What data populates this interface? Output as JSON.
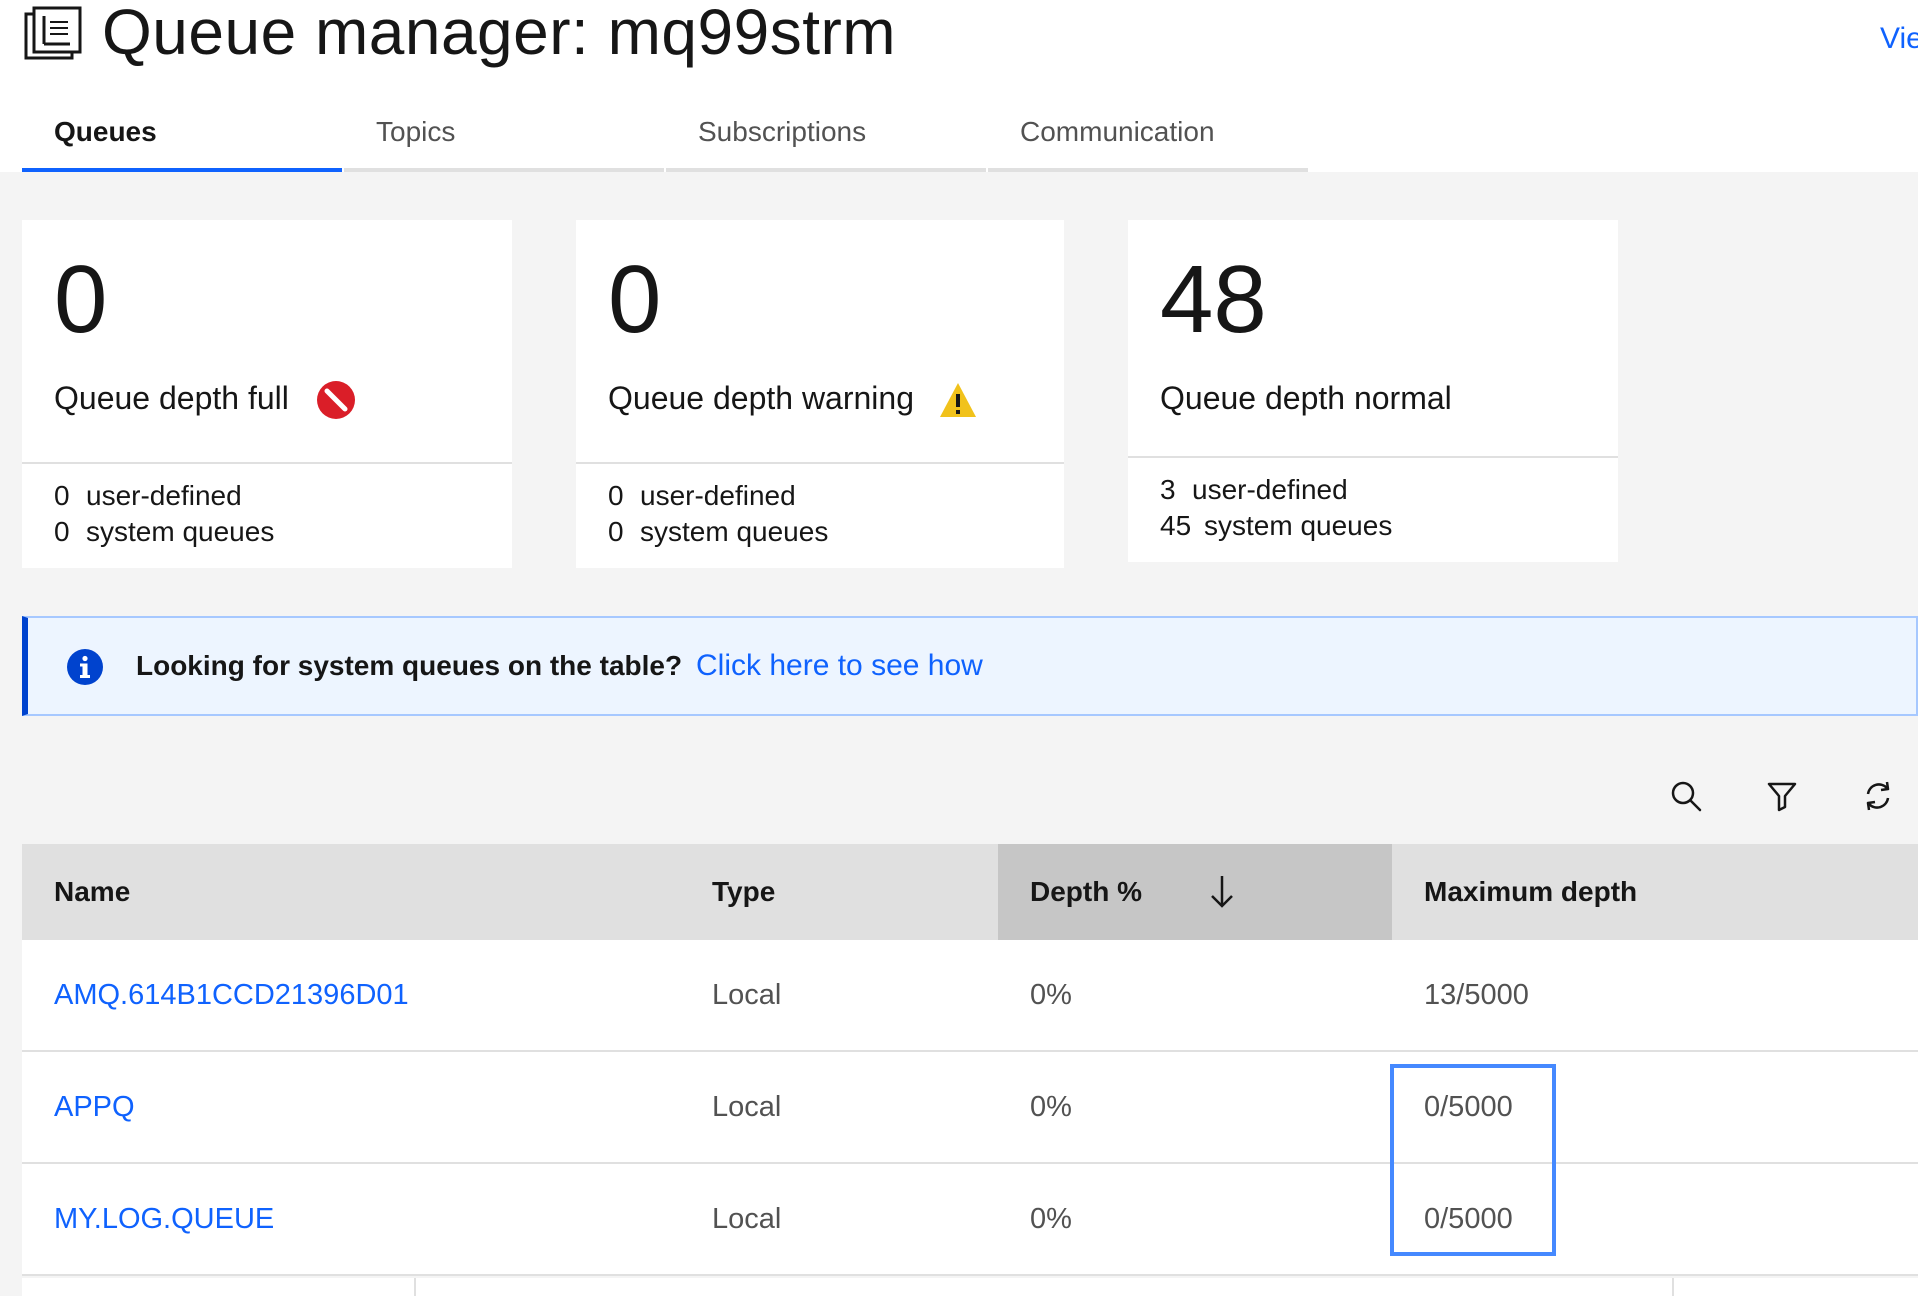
{
  "header": {
    "title": "Queue manager: mq99strm",
    "view_link": "Vie"
  },
  "tabs": [
    {
      "label": "Queues",
      "active": true
    },
    {
      "label": "Topics",
      "active": false
    },
    {
      "label": "Subscriptions",
      "active": false
    },
    {
      "label": "Communication",
      "active": false
    }
  ],
  "cards": [
    {
      "count": "0",
      "label": "Queue depth full",
      "status_icon": "blocked-icon",
      "user_defined_count": "0",
      "user_defined_label": "user-defined",
      "system_count": "0",
      "system_label": "system queues"
    },
    {
      "count": "0",
      "label": "Queue depth warning",
      "status_icon": "warning-icon",
      "user_defined_count": "0",
      "user_defined_label": "user-defined",
      "system_count": "0",
      "system_label": "system queues"
    },
    {
      "count": "48",
      "label": "Queue depth normal",
      "status_icon": "",
      "user_defined_count": "3",
      "user_defined_label": "user-defined",
      "system_count": "45",
      "system_label": "system queues"
    }
  ],
  "notification": {
    "title": "Looking for system queues on the table?",
    "link": "Click here to see how",
    "icon": "info-icon"
  },
  "toolbar": {
    "icons": [
      "search-icon",
      "filter-icon",
      "refresh-icon"
    ]
  },
  "table": {
    "columns": [
      "Name",
      "Type",
      "Depth %",
      "Maximum depth"
    ],
    "sorted_column": "Depth %",
    "sort_direction": "descending",
    "rows": [
      {
        "name": "AMQ.614B1CCD21396D01",
        "type": "Local",
        "depth": "0%",
        "max_depth": "13/5000"
      },
      {
        "name": "APPQ",
        "type": "Local",
        "depth": "0%",
        "max_depth": "0/5000"
      },
      {
        "name": "MY.LOG.QUEUE",
        "type": "Local",
        "depth": "0%",
        "max_depth": "0/5000"
      }
    ]
  },
  "colors": {
    "accent": "#0f62fe",
    "error": "#da1e28",
    "warning": "#f1c21b",
    "info": "#0043ce"
  }
}
